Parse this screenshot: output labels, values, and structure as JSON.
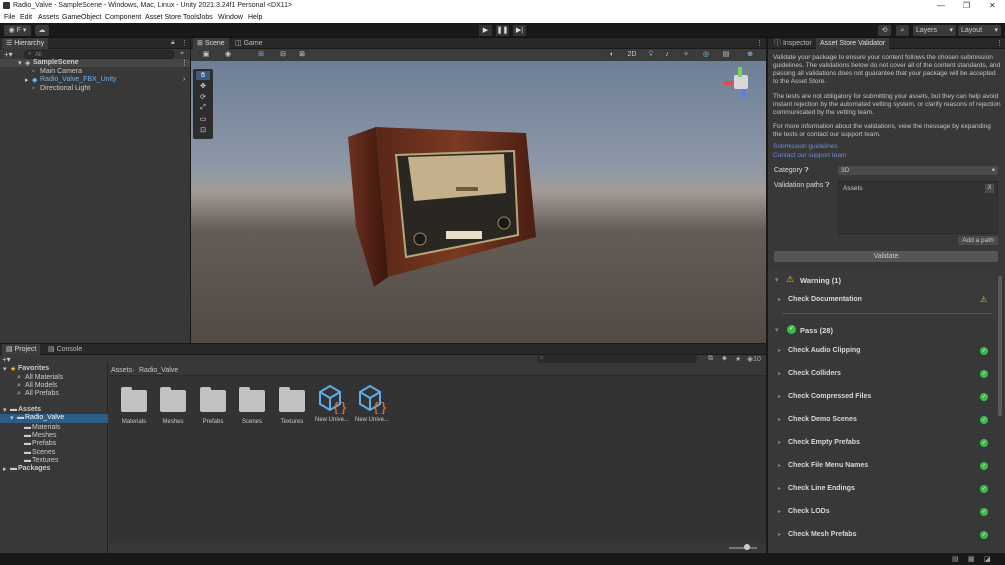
{
  "window": {
    "title": "Radio_Valve - SampleScene - Windows, Mac, Linux - Unity 2021.3.24f1 Personal <DX11>"
  },
  "menu": [
    "File",
    "Edit",
    "Assets",
    "GameObject",
    "Component",
    "Asset Store Tools",
    "Jobs",
    "Window",
    "Help"
  ],
  "toolbar": {
    "account": "F",
    "layers": "Layers",
    "layout": "Layout"
  },
  "hierarchy": {
    "tab": "Hierarchy",
    "search_placeholder": "All",
    "items": [
      "SampleScene",
      "Main Camera",
      "Radio_Valve_FBX_Unity",
      "Directional Light"
    ]
  },
  "scene": {
    "tabs": [
      "Scene",
      "Game"
    ],
    "mode2d": "2D"
  },
  "inspector": {
    "tabs": [
      "Inspector",
      "Asset Store Validator"
    ],
    "para1": "Validate your package to ensure your content follows the chosen submission guidelines. The validations below do not cover all of the content standards, and passing all validations does not guarantee that your package will be accepted to the Asset Store.",
    "para2": "The tests are not obligatory for submitting your assets, but they can help avoid instant rejection by the automated vetting system, or clarify reasons of rejection communicated by the vetting team.",
    "para3": "For more information about the validations, view the message by expanding the tests or contact our support team.",
    "link1": "Submission guidelines",
    "link2": "Contact our support team",
    "category_label": "Category",
    "category_value": "3D",
    "paths_label": "Validation paths",
    "paths_value": "Assets",
    "remove": "X",
    "add_path": "Add a path",
    "validate": "Validate",
    "warning_header": "Warning (1)",
    "warning_items": [
      "Check Documentation"
    ],
    "pass_header": "Pass (28)",
    "pass_items": [
      "Check Audio Clipping",
      "Check Colliders",
      "Check Compressed Files",
      "Check Demo Scenes",
      "Check Empty Prefabs",
      "Check File Menu Names",
      "Check Line Endings",
      "Check LODs",
      "Check Mesh Prefabs"
    ]
  },
  "project": {
    "tabs": [
      "Project",
      "Console"
    ],
    "favorites": "Favorites",
    "fav_items": [
      "All Materials",
      "All Models",
      "All Prefabs"
    ],
    "assets": "Assets",
    "selected": "Radio_Valve",
    "sub_items": [
      "Materials",
      "Meshes",
      "Prefabs",
      "Scenes",
      "Textures"
    ],
    "packages": "Packages",
    "breadcrumb_root": "Assets",
    "breadcrumb_current": "Radio_Valve",
    "hidden_count": "10",
    "grid": [
      "Materials",
      "Meshes",
      "Prefabs",
      "Scenes",
      "Textures",
      "New Unive...",
      "New Unive..."
    ]
  }
}
